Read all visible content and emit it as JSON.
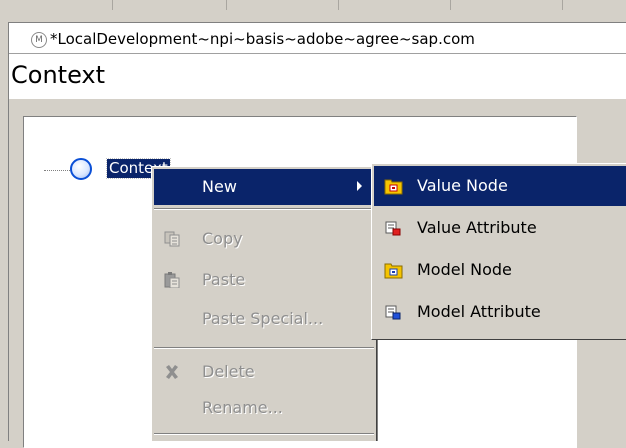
{
  "editor": {
    "title": "*LocalDevelopment~npi~basis~adobe~agree~sap.com",
    "title_icon_glyph": "M",
    "section_title": "Context"
  },
  "tree": {
    "root_label": "Context"
  },
  "context_menu": {
    "items": [
      {
        "label": "New",
        "icon": "none",
        "state": "highlighted",
        "has_submenu": true
      },
      {
        "label": "Copy",
        "icon": "copy-icon",
        "state": "disabled"
      },
      {
        "label": "Paste",
        "icon": "paste-icon",
        "state": "disabled"
      },
      {
        "label": "Paste Special...",
        "icon": "none",
        "state": "disabled"
      },
      {
        "label": "Delete",
        "icon": "delete-icon",
        "state": "disabled"
      },
      {
        "label": "Rename...",
        "icon": "none",
        "state": "disabled"
      }
    ]
  },
  "submenu": {
    "items": [
      {
        "label": "Value Node",
        "icon": "value-node-icon",
        "state": "highlighted"
      },
      {
        "label": "Value Attribute",
        "icon": "value-attribute-icon",
        "state": "normal"
      },
      {
        "label": "Model Node",
        "icon": "model-node-icon",
        "state": "normal"
      },
      {
        "label": "Model Attribute",
        "icon": "model-attribute-icon",
        "state": "normal"
      }
    ]
  },
  "colors": {
    "selection": "#0a246a",
    "face": "#d4d0c8",
    "disabled_text": "#8f8f8f"
  }
}
